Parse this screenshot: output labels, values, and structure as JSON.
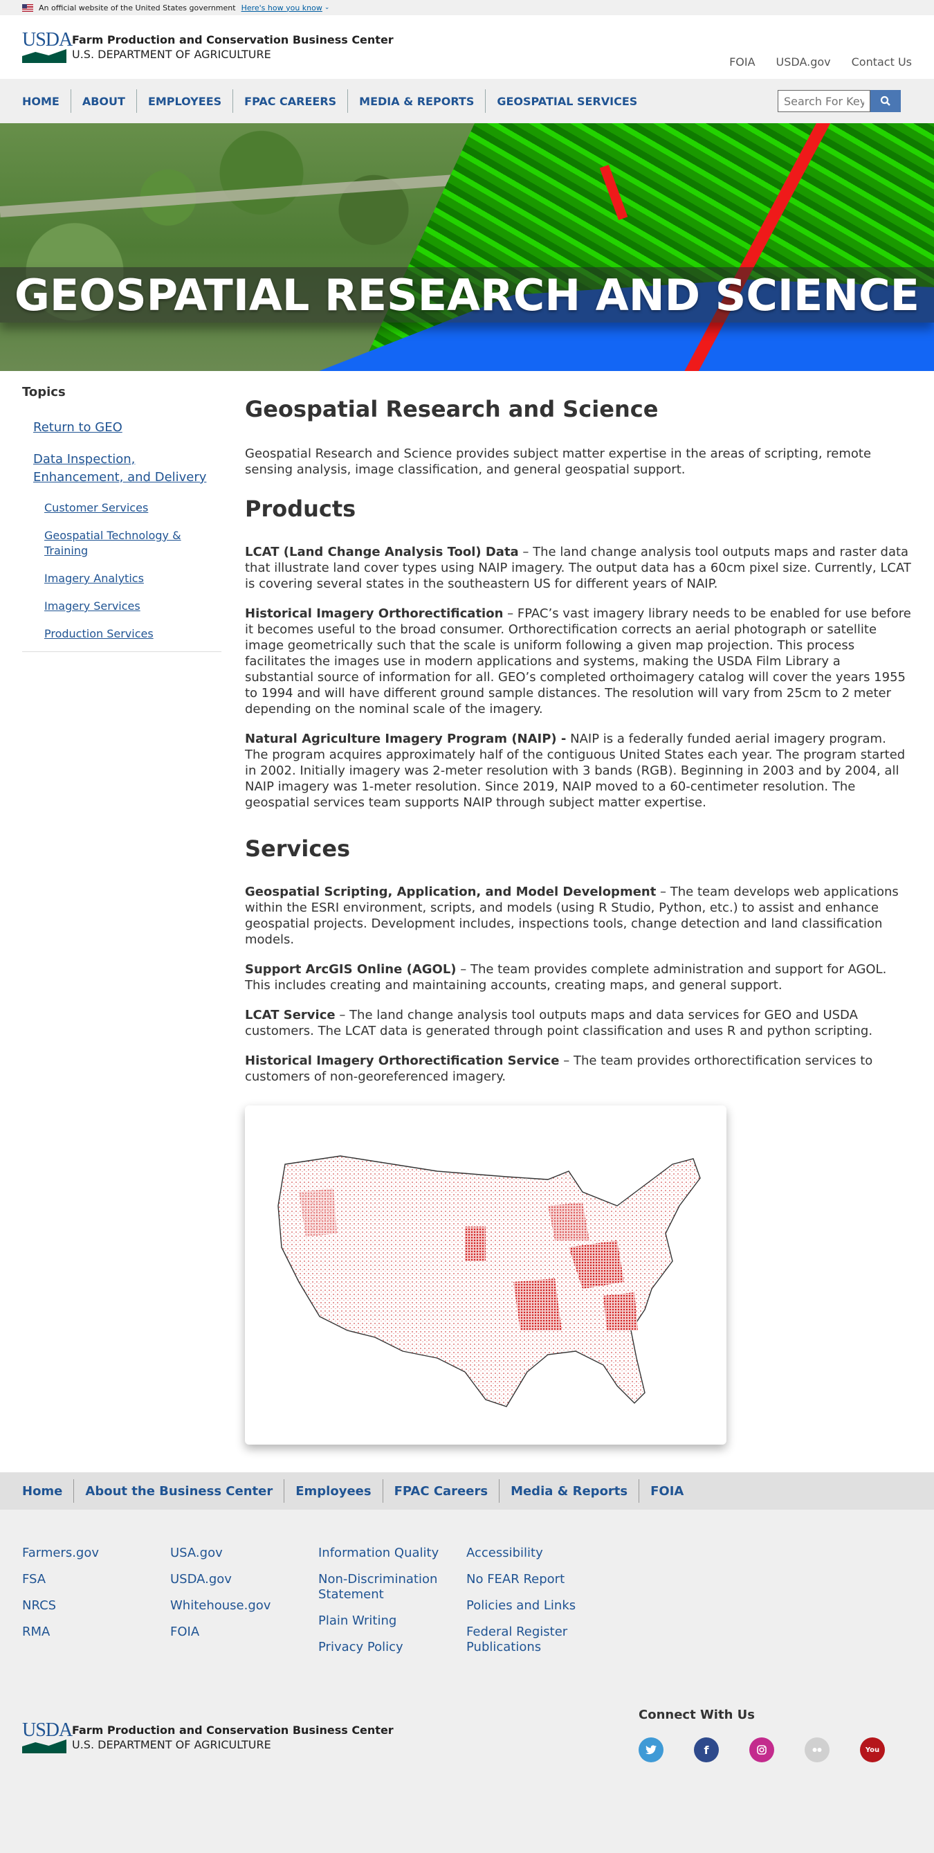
{
  "gov_banner": {
    "text": "An official website of the United States government",
    "link": "Here's how you know"
  },
  "header": {
    "logo_text": "USDA",
    "agency": "Farm Production and Conservation Business Center",
    "department": "U.S. DEPARTMENT OF AGRICULTURE",
    "util_links": [
      "FOIA",
      "USDA.gov",
      "Contact Us"
    ]
  },
  "nav": {
    "items": [
      "HOME",
      "ABOUT",
      "EMPLOYEES",
      "FPAC CAREERS",
      "MEDIA & REPORTS",
      "GEOSPATIAL SERVICES"
    ],
    "search_placeholder": "Search For Keywords"
  },
  "hero": {
    "title": "GEOSPATIAL RESEARCH AND SCIENCE"
  },
  "sidebar": {
    "title": "Topics",
    "level1": [
      "Return to GEO",
      "Data Inspection, Enhancement, and Delivery"
    ],
    "level2": [
      "Customer Services",
      "Geospatial Technology & Training",
      "Imagery Analytics",
      "Imagery Services",
      "Production Services"
    ]
  },
  "content": {
    "title": "Geospatial Research and Science",
    "intro": "Geospatial Research and Science provides subject matter expertise in the areas of scripting, remote sensing analysis, image classification, and general geospatial support.",
    "products_heading": "Products",
    "products": [
      {
        "name": "LCAT (Land Change Analysis Tool) Data",
        "text": " – The land change analysis tool outputs maps and raster data that illustrate land cover types using NAIP imagery. The output data has a 60cm pixel size. Currently, LCAT is covering several states in the southeastern US for different years of NAIP."
      },
      {
        "name": "Historical Imagery Orthorectification",
        "text": " – FPAC’s vast imagery library needs to be enabled for use before it becomes useful to the broad consumer. Orthorectification corrects an aerial photograph or satellite image geometrically such that the scale is uniform following a given map projection. This process facilitates the images use in modern applications and systems, making the USDA Film Library a substantial source of information for all. GEO’s completed orthoimagery catalog will cover the years 1955 to 1994 and will have different ground sample distances. The resolution will vary from 25cm to 2 meter depending on the nominal scale of the imagery."
      },
      {
        "name": "Natural Agriculture Imagery Program (NAIP) -",
        "text": " NAIP is a federally funded aerial imagery program. The program acquires approximately half of the contiguous United States each year. The program started in 2002. Initially imagery was 2-meter resolution with 3 bands (RGB). Beginning in 2003 and by 2004, all NAIP imagery was 1-meter resolution. Since 2019, NAIP moved to a 60-centimeter resolution. The geospatial services team supports NAIP through subject matter expertise."
      }
    ],
    "services_heading": "Services",
    "services": [
      {
        "name": "Geospatial Scripting, Application, and Model Development",
        "text": " – The team develops web applications within the ESRI environment, scripts, and models (using R Studio, Python, etc.) to assist and enhance geospatial projects. Development includes, inspections tools, change detection and land classification models."
      },
      {
        "name": "Support ArcGIS Online (AGOL)",
        "text": " – The team provides complete administration and support for AGOL. This includes creating and maintaining accounts, creating maps, and general support."
      },
      {
        "name": "LCAT Service",
        "text": " – The land change analysis tool outputs maps and data services for GEO and USDA customers. The LCAT data is generated through point classification and uses R and python scripting."
      },
      {
        "name": "Historical Imagery Orthorectification Service",
        "text": " – The team provides orthorectification services to customers of non-georeferenced imagery."
      }
    ]
  },
  "footer_nav": [
    "Home",
    "About the Business Center",
    "Employees",
    "FPAC Careers",
    "Media & Reports",
    "FOIA"
  ],
  "footer_columns": [
    [
      "Farmers.gov",
      "FSA",
      "NRCS",
      "RMA"
    ],
    [
      "USA.gov",
      "USDA.gov",
      "Whitehouse.gov",
      "FOIA"
    ],
    [
      "Information Quality",
      "Non-Discrimination Statement",
      "Plain Writing",
      "Privacy Policy"
    ],
    [
      "Accessibility",
      "No FEAR Report",
      "Policies and Links",
      "Federal Register Publications"
    ]
  ],
  "footer": {
    "agency": "Farm Production and Conservation Business Center",
    "department": "U.S. DEPARTMENT OF AGRICULTURE",
    "connect_title": "Connect With Us",
    "social": [
      {
        "name": "twitter",
        "color": "#3f9ad6"
      },
      {
        "name": "facebook",
        "color": "#2e4a8c"
      },
      {
        "name": "instagram",
        "color": "#c32b8d"
      },
      {
        "name": "flickr",
        "color": "#d0d0d0"
      },
      {
        "name": "youtube",
        "color": "#b5161b"
      }
    ]
  }
}
